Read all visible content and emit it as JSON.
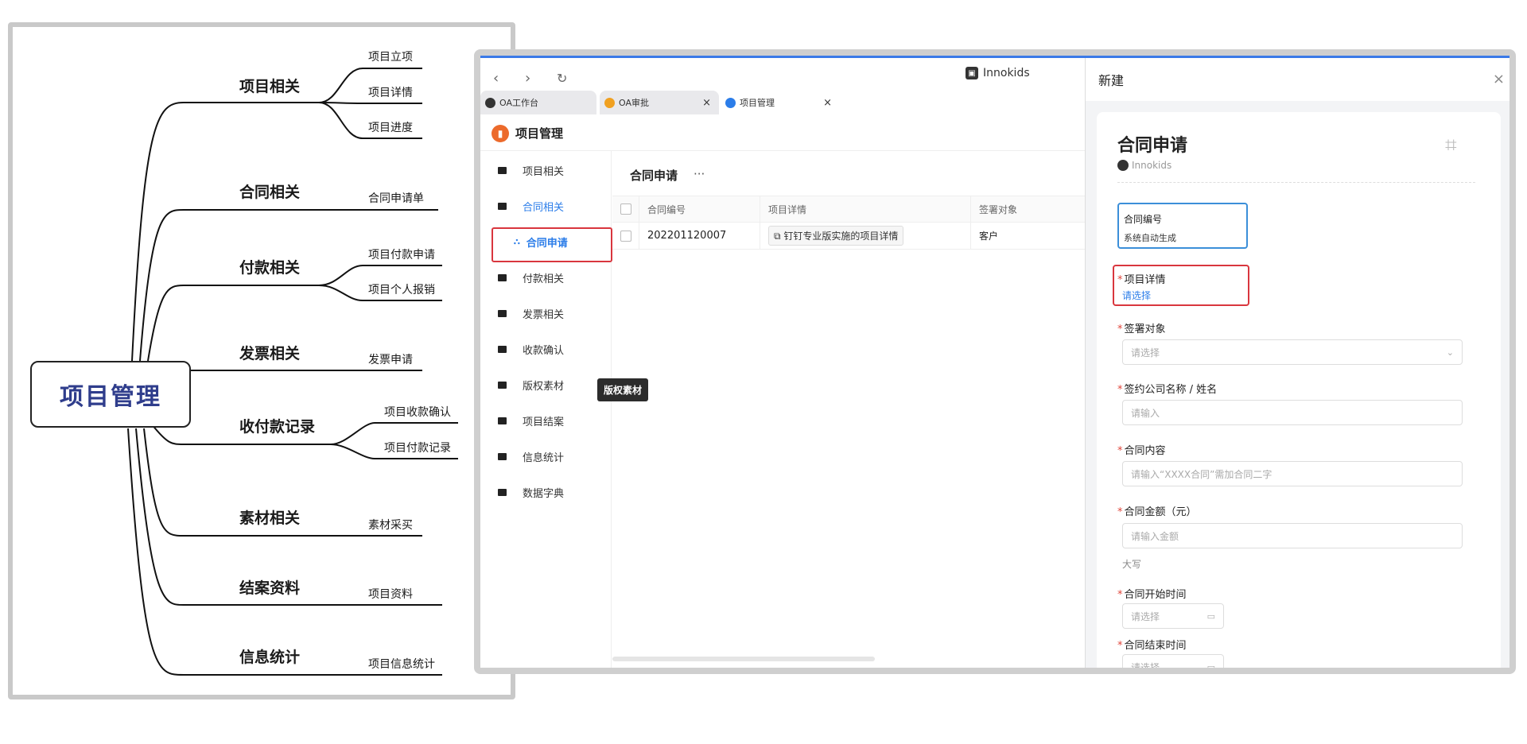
{
  "mindmap": {
    "root": "项目管理",
    "branches": [
      {
        "label": "项目相关",
        "leaves": [
          "项目立项",
          "项目详情",
          "项目进度"
        ]
      },
      {
        "label": "合同相关",
        "leaves": [
          "合同申请单"
        ]
      },
      {
        "label": "付款相关",
        "leaves": [
          "项目付款申请",
          "项目个人报销"
        ]
      },
      {
        "label": "发票相关",
        "leaves": [
          "发票申请"
        ]
      },
      {
        "label": "收付款记录",
        "leaves": [
          "项目收款确认",
          "项目付款记录"
        ]
      },
      {
        "label": "素材相关",
        "leaves": [
          "素材采买"
        ]
      },
      {
        "label": "结案资料",
        "leaves": [
          "项目资料"
        ]
      },
      {
        "label": "信息统计",
        "leaves": [
          "项目信息统计"
        ]
      }
    ]
  },
  "browser": {
    "brand": "Innokids",
    "tabs": [
      {
        "label": "OA工作台",
        "icon_color": "#333333"
      },
      {
        "label": "OA审批",
        "icon_color": "#f0a020"
      },
      {
        "label": "项目管理",
        "icon_color": "#2b7de9"
      }
    ]
  },
  "app": {
    "title": "项目管理",
    "sidebar": [
      {
        "label": "项目相关"
      },
      {
        "label": "合同相关"
      },
      {
        "label": "合同申请"
      },
      {
        "label": "付款相关"
      },
      {
        "label": "发票相关"
      },
      {
        "label": "收款确认"
      },
      {
        "label": "版权素材"
      },
      {
        "label": "项目结案"
      },
      {
        "label": "信息统计"
      },
      {
        "label": "数据字典"
      }
    ],
    "tooltip": "版权素材",
    "main": {
      "title": "合同申请",
      "more": "···",
      "columns": [
        "合同编号",
        "项目详情",
        "签署对象"
      ],
      "rows": [
        {
          "contract_no": "202201120007",
          "project": "钉钉专业版实施的项目详情",
          "party": "客户"
        }
      ]
    }
  },
  "drawer": {
    "header": "新建",
    "close": "×",
    "form_title": "合同申请",
    "org": "Innokids",
    "fields": {
      "contract_no_label": "合同编号",
      "contract_no_value": "系统自动生成",
      "project_label": "项目详情",
      "project_value": "请选择",
      "party_label": "签署对象",
      "party_placeholder": "请选择",
      "company_label": "签约公司名称 / 姓名",
      "company_placeholder": "请输入",
      "content_label": "合同内容",
      "content_placeholder": "请输入“XXXX合同”需加合同二字",
      "amount_label": "合同金额（元）",
      "amount_placeholder": "请输入金额",
      "amount_caps": "大写",
      "start_label": "合同开始时间",
      "start_placeholder": "请选择",
      "end_label": "合同结束时间",
      "end_placeholder": "请选择"
    }
  }
}
